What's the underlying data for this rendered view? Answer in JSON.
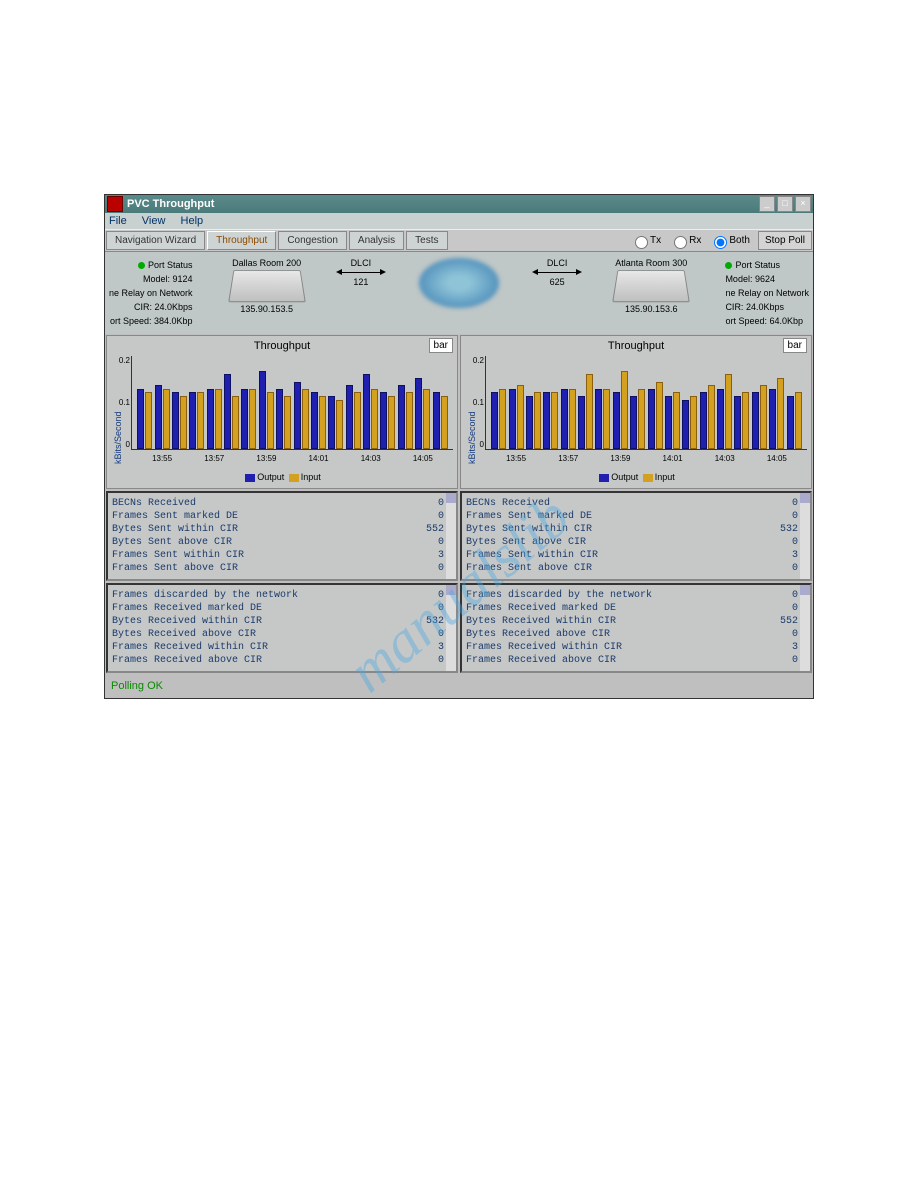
{
  "window": {
    "title": "PVC Throughput"
  },
  "menubar": [
    "File",
    "View",
    "Help"
  ],
  "tabs": [
    "Navigation Wizard",
    "Throughput",
    "Congestion",
    "Analysis",
    "Tests"
  ],
  "radios": {
    "tx": "Tx",
    "rx": "Rx",
    "both": "Both"
  },
  "toolbar": {
    "stop_poll": "Stop Poll"
  },
  "left": {
    "port_status": "Port Status",
    "model": "Model: 9124",
    "relay": "ne Relay on Network",
    "cir": "CIR: 24.0Kbps",
    "speed": "ort Speed: 384.0Kbp",
    "room": "Dallas Room 200",
    "ip": "135.90.153.5"
  },
  "right": {
    "port_status": "Port Status",
    "model": "Model: 9624",
    "relay": "ne Relay on Network",
    "cir": "CIR: 24.0Kbps",
    "speed": "ort Speed: 64.0Kbp",
    "room": "Atlanta Room 300",
    "ip": "135.90.153.6"
  },
  "dlci": {
    "label": "DLCI",
    "left_val": "121",
    "right_val": "625"
  },
  "charts": {
    "0": {
      "title": "Throughput",
      "type": "bar",
      "ylabel": "kBits/Second"
    },
    "1": {
      "title": "Throughput",
      "type": "bar",
      "ylabel": "kBits/Second"
    },
    "legend": {
      "output": "Output",
      "input": "Input"
    }
  },
  "chart_data": [
    {
      "type": "bar",
      "title": "Throughput",
      "ylabel": "kBits/Second",
      "ylim": [
        0,
        0.22
      ],
      "yticks": [
        "0",
        "0.1",
        "0.2"
      ],
      "categories": [
        "13:55",
        "13:57",
        "13:59",
        "14:01",
        "14:03",
        "14:05"
      ],
      "series": [
        {
          "name": "Output",
          "values": [
            0.16,
            0.17,
            0.15,
            0.15,
            0.16,
            0.2,
            0.16,
            0.21,
            0.16,
            0.18,
            0.15,
            0.14,
            0.17,
            0.2,
            0.15,
            0.17,
            0.19,
            0.15
          ]
        },
        {
          "name": "Input",
          "values": [
            0.15,
            0.16,
            0.14,
            0.15,
            0.16,
            0.14,
            0.16,
            0.15,
            0.14,
            0.16,
            0.14,
            0.13,
            0.15,
            0.16,
            0.14,
            0.15,
            0.16,
            0.14
          ]
        }
      ]
    },
    {
      "type": "bar",
      "title": "Throughput",
      "ylabel": "kBits/Second",
      "ylim": [
        0,
        0.22
      ],
      "yticks": [
        "0",
        "0.1",
        "0.2"
      ],
      "categories": [
        "13:55",
        "13:57",
        "13:59",
        "14:01",
        "14:03",
        "14:05"
      ],
      "series": [
        {
          "name": "Output",
          "values": [
            0.15,
            0.16,
            0.14,
            0.15,
            0.16,
            0.14,
            0.16,
            0.15,
            0.14,
            0.16,
            0.14,
            0.13,
            0.15,
            0.16,
            0.14,
            0.15,
            0.16,
            0.14
          ]
        },
        {
          "name": "Input",
          "values": [
            0.16,
            0.17,
            0.15,
            0.15,
            0.16,
            0.2,
            0.16,
            0.21,
            0.16,
            0.18,
            0.15,
            0.14,
            0.17,
            0.2,
            0.15,
            0.17,
            0.19,
            0.15
          ]
        }
      ]
    }
  ],
  "stats_sent": [
    {
      "label": "Frames Sent above CIR",
      "v0": "0",
      "v1": "0"
    },
    {
      "label": "Frames Sent within CIR",
      "v0": "3",
      "v1": "3"
    },
    {
      "label": "Bytes Sent above CIR",
      "v0": "0",
      "v1": "0"
    },
    {
      "label": "Bytes Sent within CIR",
      "v0": "552",
      "v1": "532"
    },
    {
      "label": "Frames Sent marked DE",
      "v0": "0",
      "v1": "0"
    },
    {
      "label": "BECNs Received",
      "v0": "0",
      "v1": "0"
    }
  ],
  "stats_recv": [
    {
      "label": "Frames Received above CIR",
      "v0": "0",
      "v1": "0"
    },
    {
      "label": "Frames Received within CIR",
      "v0": "3",
      "v1": "3"
    },
    {
      "label": "Bytes Received above CIR",
      "v0": "0",
      "v1": "0"
    },
    {
      "label": "Bytes Received within CIR",
      "v0": "532",
      "v1": "552"
    },
    {
      "label": "Frames Received marked DE",
      "v0": "0",
      "v1": "0"
    },
    {
      "label": "Frames discarded by the network",
      "v0": "0",
      "v1": "0"
    }
  ],
  "statusbar": "Polling OK",
  "watermark": "manualslib"
}
